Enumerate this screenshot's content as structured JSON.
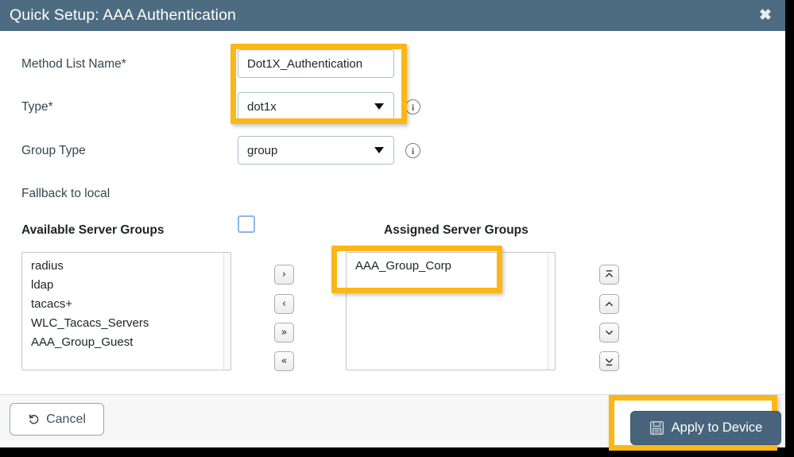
{
  "dialog": {
    "title": "Quick Setup: AAA Authentication",
    "close_icon": "close-icon"
  },
  "form": {
    "method_list_name": {
      "label": "Method List Name*",
      "value": "Dot1X_Authentication",
      "placeholder": ""
    },
    "type": {
      "label": "Type*",
      "value": "dot1x",
      "options": [
        "dot1x"
      ],
      "info_icon": "info-icon"
    },
    "group_type": {
      "label": "Group Type",
      "value": "group",
      "options": [
        "group"
      ],
      "info_icon": "info-icon"
    },
    "fallback_to_local": {
      "label": "Fallback to local",
      "checked": false
    }
  },
  "server_groups": {
    "available": {
      "heading": "Available Server Groups",
      "items": [
        "radius",
        "ldap",
        "tacacs+",
        "WLC_Tacacs_Servers",
        "AAA_Group_Guest"
      ]
    },
    "assigned": {
      "heading": "Assigned Server Groups",
      "items": [
        "AAA_Group_Corp"
      ]
    },
    "transfer_buttons": [
      {
        "name": "move-right-button",
        "glyph": "›"
      },
      {
        "name": "move-left-button",
        "glyph": "‹"
      },
      {
        "name": "move-all-right-button",
        "glyph": "»"
      },
      {
        "name": "move-all-left-button",
        "glyph": "«"
      }
    ],
    "order_buttons": [
      {
        "name": "move-to-top-button"
      },
      {
        "name": "move-up-button"
      },
      {
        "name": "move-down-button"
      },
      {
        "name": "move-to-bottom-button"
      }
    ]
  },
  "footer": {
    "cancel_label": "Cancel",
    "cancel_icon": "undo-icon",
    "apply_label": "Apply to Device",
    "apply_icon": "save-floppy-icon"
  },
  "colors": {
    "titlebar": "#4e6c81",
    "primary_button": "#47647c",
    "highlight": "#fbb715",
    "label_text": "#32484f"
  }
}
